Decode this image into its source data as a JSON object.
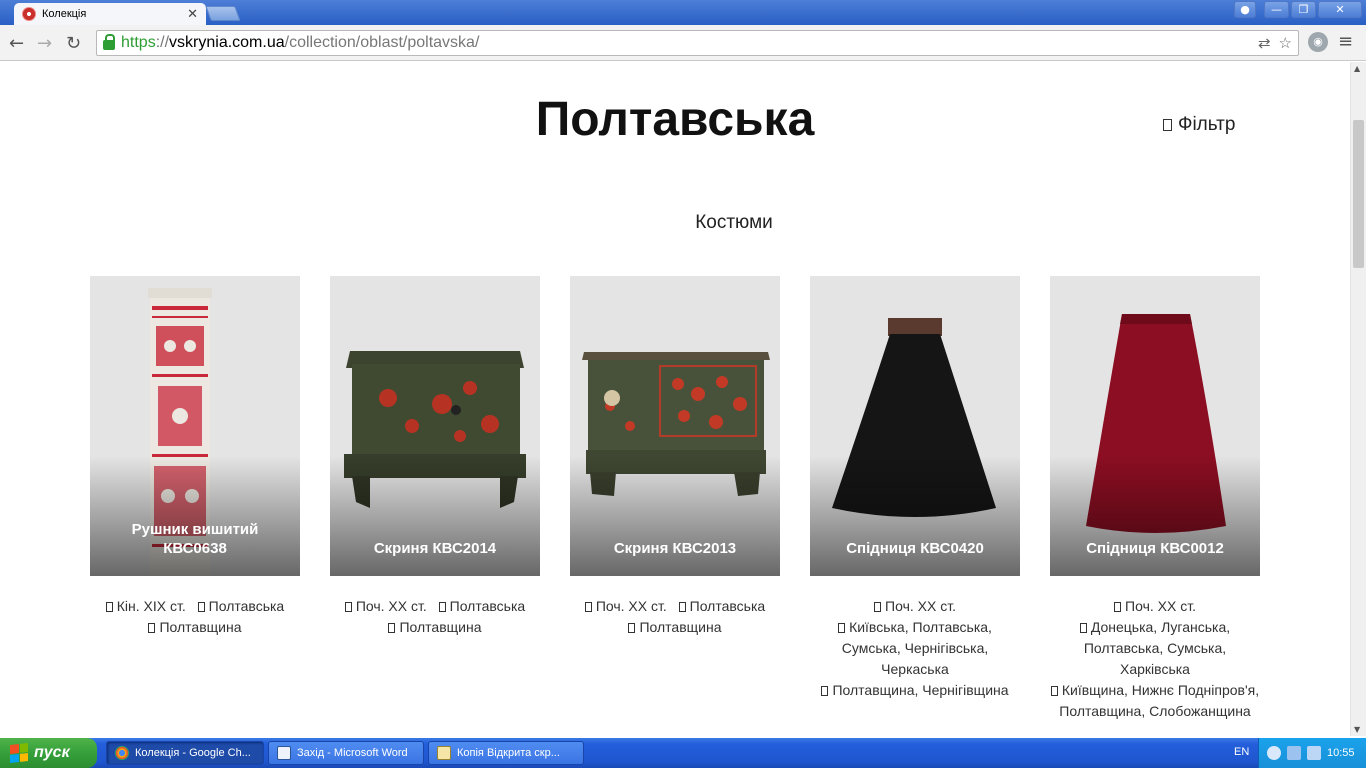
{
  "browser": {
    "tab_title": "Колекція",
    "tab_close": "✕",
    "url_scheme": "https",
    "url_sep": "://",
    "url_host": "vskrynia.com.ua",
    "url_path": "/collection/oblast/poltavska/",
    "window_buttons": [
      "—",
      "❐",
      "✕"
    ]
  },
  "page": {
    "title": "Полтавська",
    "filter_label": "Фільтр",
    "category": "Костюми"
  },
  "cards": [
    {
      "title": "Рушник вишитий КВС0638",
      "meta": [
        "Кін. XIX ст.",
        "Полтавська",
        "Полтавщина"
      ]
    },
    {
      "title": "Скриня КВС2014",
      "meta": [
        "Поч. XX ст.",
        "Полтавська",
        "Полтавщина"
      ]
    },
    {
      "title": "Скриня КВС2013",
      "meta": [
        "Поч. XX ст.",
        "Полтавська",
        "Полтавщина"
      ]
    },
    {
      "title": "Спідниця КВС0420",
      "meta": [
        "Поч. XX ст.",
        "Київська, Полтавська, Сумська, Чернігівська, Черкаська",
        "Полтавщина, Чернігівщина"
      ]
    },
    {
      "title": "Спідниця КВС0012",
      "meta": [
        "Поч. XX ст.",
        "Донецька, Луганська, Полтавська, Сумська, Харківська",
        "Київщина, Нижнє Подніпров'я, Полтавщина, Слобожанщина"
      ]
    }
  ],
  "taskbar": {
    "start_label": "пуск",
    "tasks": [
      "Колекція - Google Ch...",
      "Захід - Microsoft Word",
      "Копія Відкрита скр..."
    ],
    "lang": "EN",
    "clock": "10:55"
  }
}
